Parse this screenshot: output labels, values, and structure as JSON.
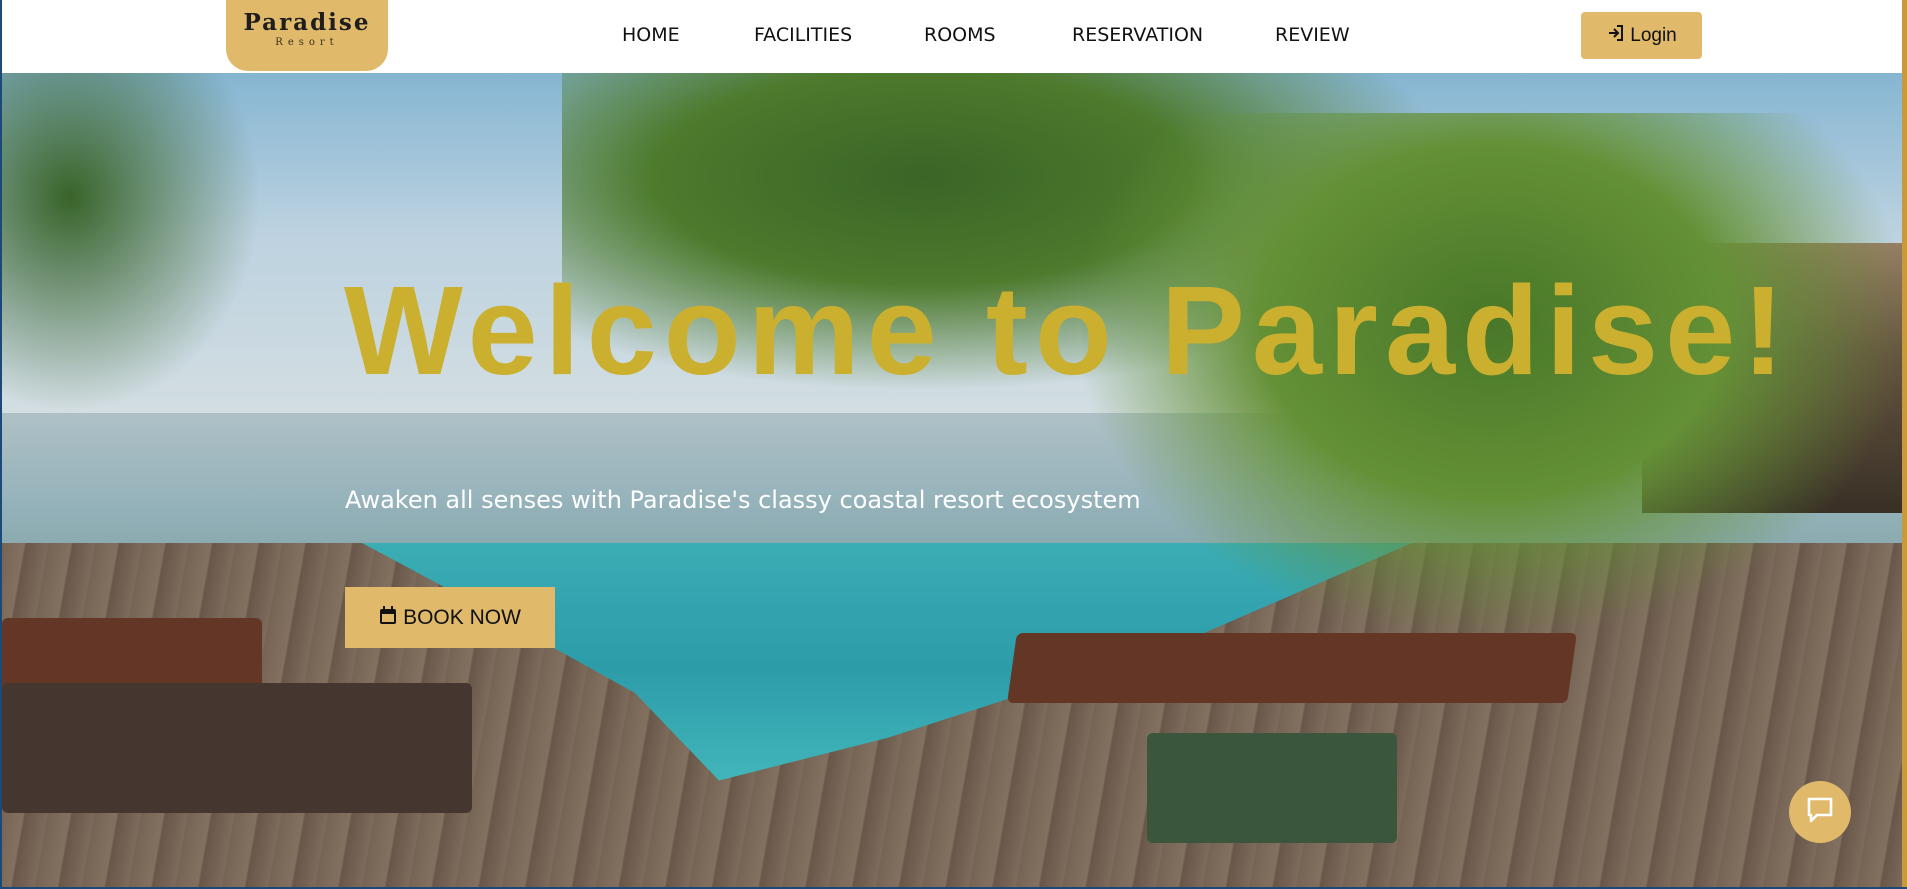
{
  "brand": {
    "name": "Paradise",
    "tagline": "Resort",
    "accent_color": "#e0b96b",
    "title_color": "#cbb030"
  },
  "nav": {
    "items": [
      {
        "label": "HOME"
      },
      {
        "label": "FACILITIES"
      },
      {
        "label": "ROOMS"
      },
      {
        "label": "RESERVATION"
      },
      {
        "label": "REVIEW"
      }
    ],
    "login": {
      "label": "Login",
      "icon": "sign-in-icon"
    }
  },
  "hero": {
    "title": "Welcome to Paradise!",
    "subtitle": "Awaken all senses with Paradise's classy coastal resort ecosystem",
    "cta": {
      "label": "BOOK NOW",
      "icon": "calendar-icon"
    },
    "background": "beach-resort-pool-photo"
  },
  "chat": {
    "icon": "chat-bubble-icon"
  }
}
